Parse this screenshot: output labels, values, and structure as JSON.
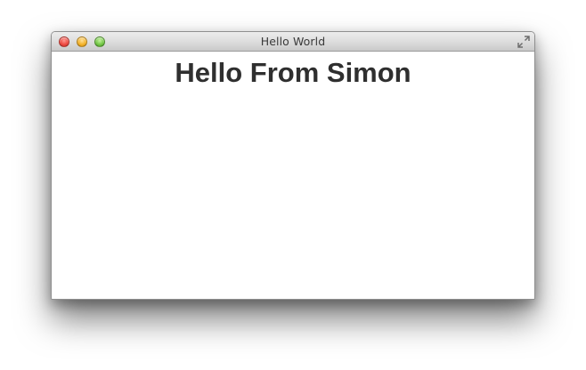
{
  "window": {
    "title": "Hello World",
    "controls": {
      "close": "close-button",
      "minimize": "minimize-button",
      "zoom": "zoom-button",
      "fullscreen": "fullscreen-icon"
    }
  },
  "content": {
    "heading": "Hello From Simon"
  },
  "colors": {
    "close": "#ee4b43",
    "minimize": "#f4b42b",
    "zoom": "#76c949",
    "heading_text": "#2f2f2f"
  }
}
